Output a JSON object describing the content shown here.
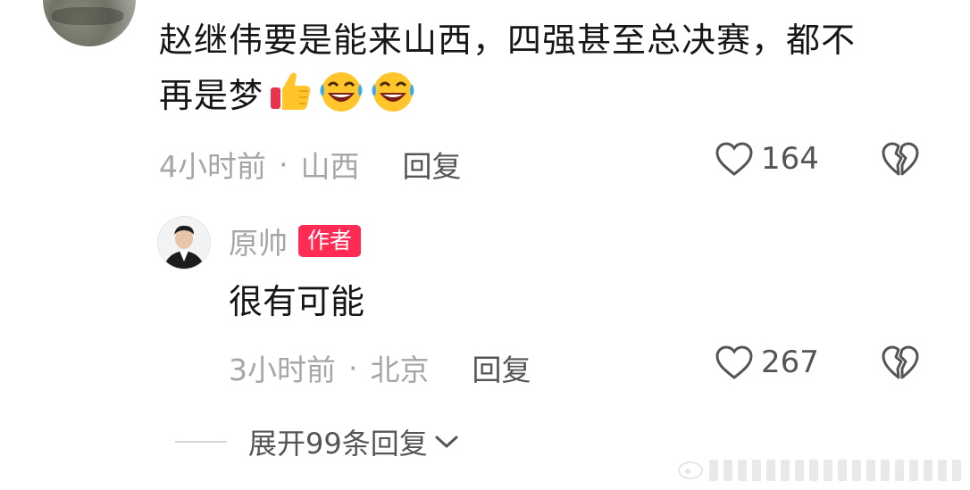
{
  "comment": {
    "text": "赵继伟要是能来山西，四强甚至总决赛，都不再是梦",
    "line1": "赵继伟要是能来山西，四强甚至总决赛，都不",
    "line2": "再是梦",
    "emojis": [
      "thumbs-up-icon",
      "rolling-laughing-icon",
      "rolling-laughing-icon"
    ],
    "time": "4小时前",
    "dot": "·",
    "location": "山西",
    "reply_label": "回复",
    "likes": "164"
  },
  "reply": {
    "author": "原帅",
    "badge": "作者",
    "text": "很有可能",
    "time": "3小时前",
    "dot": "·",
    "location": "北京",
    "reply_label": "回复",
    "likes": "267"
  },
  "expand": {
    "label": "展开99条回复"
  },
  "colors": {
    "badge": "#fe2c55",
    "meta_gray": "#a6a6a6",
    "reply_gray": "#555555"
  }
}
